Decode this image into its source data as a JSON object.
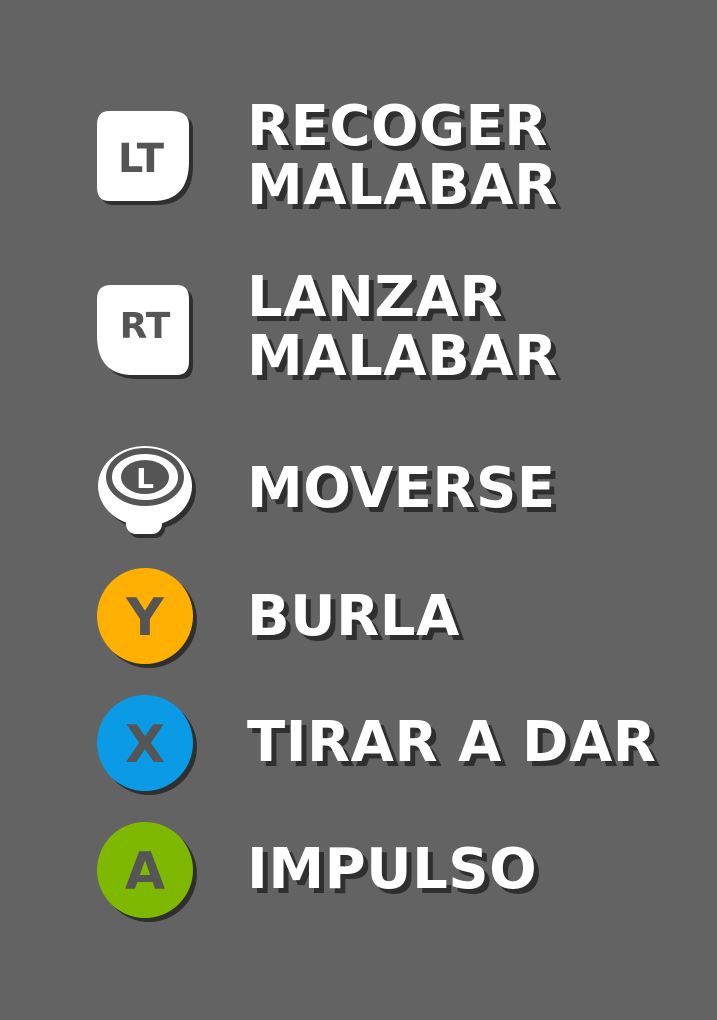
{
  "controls": [
    {
      "button": "LT",
      "action_lines": [
        "RECOGER",
        "MALABAR"
      ]
    },
    {
      "button": "RT",
      "action_lines": [
        "LANZAR",
        "MALABAR"
      ]
    },
    {
      "button": "L",
      "action_lines": [
        "MOVERSE"
      ]
    },
    {
      "button": "Y",
      "action_lines": [
        "BURLA"
      ],
      "color": "#ffb000"
    },
    {
      "button": "X",
      "action_lines": [
        "TIRAR A DAR"
      ],
      "color": "#0b9be6"
    },
    {
      "button": "A",
      "action_lines": [
        "IMPULSO"
      ],
      "color": "#7fb800"
    }
  ],
  "icons": {
    "lt": "left-trigger-icon",
    "rt": "right-trigger-icon",
    "l": "left-stick-icon",
    "y": "y-button-icon",
    "x": "x-button-icon",
    "a": "a-button-icon"
  },
  "colors": {
    "background": "#636363",
    "text": "#ffffff",
    "shadow": "#2f2f2f",
    "glyph": "#555555"
  }
}
